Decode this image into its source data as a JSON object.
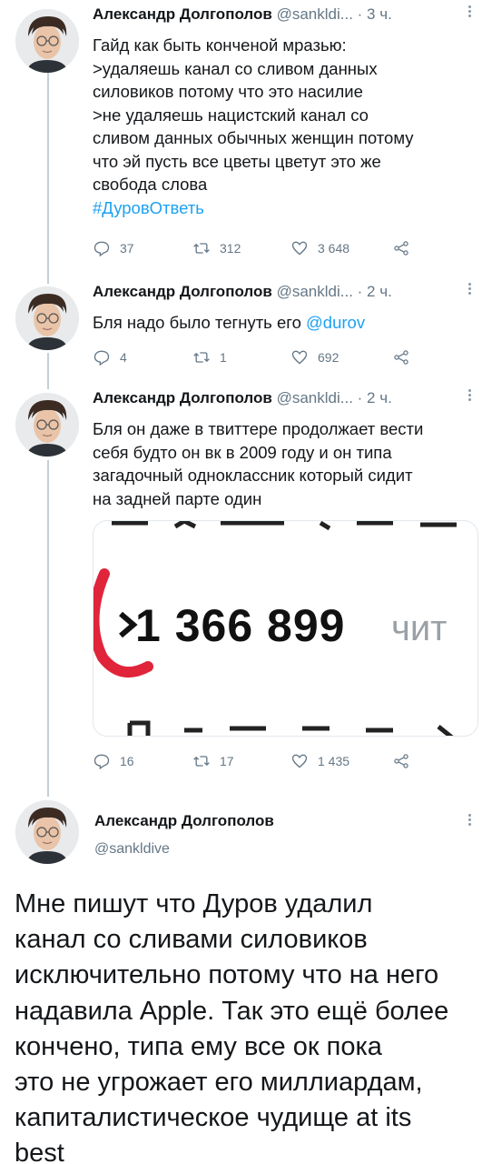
{
  "thread": [
    {
      "author_name": "Александр Долгополов",
      "handle": "@sankldi...",
      "time": "· 3 ч.",
      "lines": [
        "Гайд как быть конченой мразью:",
        ">удаляешь канал со сливом данных",
        "силовиков потому что это насилие",
        ">не удаляешь нацистский канал со",
        "сливом данных обычных женщин потому",
        "что эй пусть все цветы цветут это же",
        "свобода слова"
      ],
      "hashtag": "#ДуровОтветь",
      "replies": "37",
      "retweets": "312",
      "likes": "3 648"
    },
    {
      "author_name": "Александр Долгополов",
      "handle": "@sankldi...",
      "time": "· 2 ч.",
      "text_before_mention": "Бля надо было тегнуть его ",
      "mention": "@durov",
      "replies": "4",
      "retweets": "1",
      "likes": "692"
    },
    {
      "author_name": "Александр Долгополов",
      "handle": "@sankldi...",
      "time": "· 2 ч.",
      "lines": [
        "Бля он даже в твиттере продолжает вести",
        "себя будто он вк в 2009 году и он типа",
        "загадочный одноклассник который сидит",
        "на задней парте один"
      ],
      "media": {
        "number": "1 366 899",
        "word": "чит"
      },
      "replies": "16",
      "retweets": "17",
      "likes": "1 435"
    }
  ],
  "main_tweet": {
    "author_name": "Александр Долгополов",
    "handle": "@sankldive",
    "lines": [
      "Мне пишут что Дуров удалил",
      "канал со сливами силовиков",
      "исключительно потому что на него",
      "надавила Apple. Так это ещё более",
      "кончено, типа ему все ок пока",
      "это не угрожает его миллиардам,",
      "капиталистическое чудище at its",
      "best"
    ]
  },
  "icons": {
    "reply": "reply-icon",
    "retweet": "retweet-icon",
    "like": "heart-icon",
    "share": "share-icon",
    "more": "more-icon"
  },
  "colors": {
    "link": "#1da1f2",
    "secondary": "#657786",
    "thread_line": "#c4cfd6",
    "accent_red": "#e0243a"
  }
}
